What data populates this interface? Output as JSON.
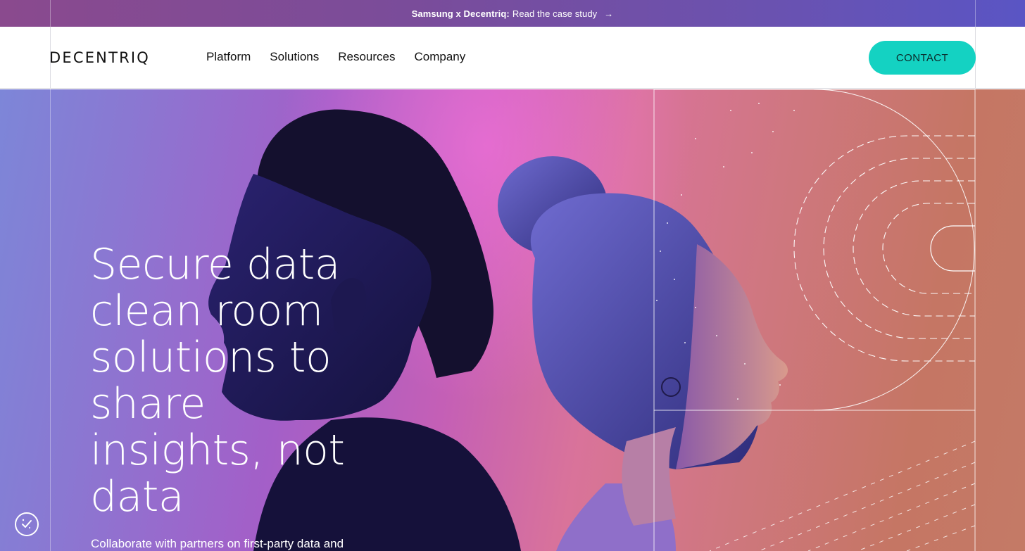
{
  "announcement": {
    "bold": "Samsung x Decentriq:",
    "text": "Read the case study",
    "arrow": "→"
  },
  "nav": {
    "logo": "DECENTRIQ",
    "items": [
      {
        "label": "Platform"
      },
      {
        "label": "Solutions"
      },
      {
        "label": "Resources"
      },
      {
        "label": "Company"
      }
    ],
    "contact": "CONTACT"
  },
  "hero": {
    "headline": "Secure data clean room solutions to share insights, not data",
    "subtext": "Collaborate with partners on first-party data and"
  },
  "icons": {
    "announcement_arrow": "arrow-right-icon",
    "cookie": "cookie-settings-icon"
  },
  "colors": {
    "accent": "#14d2c2",
    "announcement_bar_start": "#8a4a8e",
    "announcement_bar_end": "#5a55c4"
  }
}
